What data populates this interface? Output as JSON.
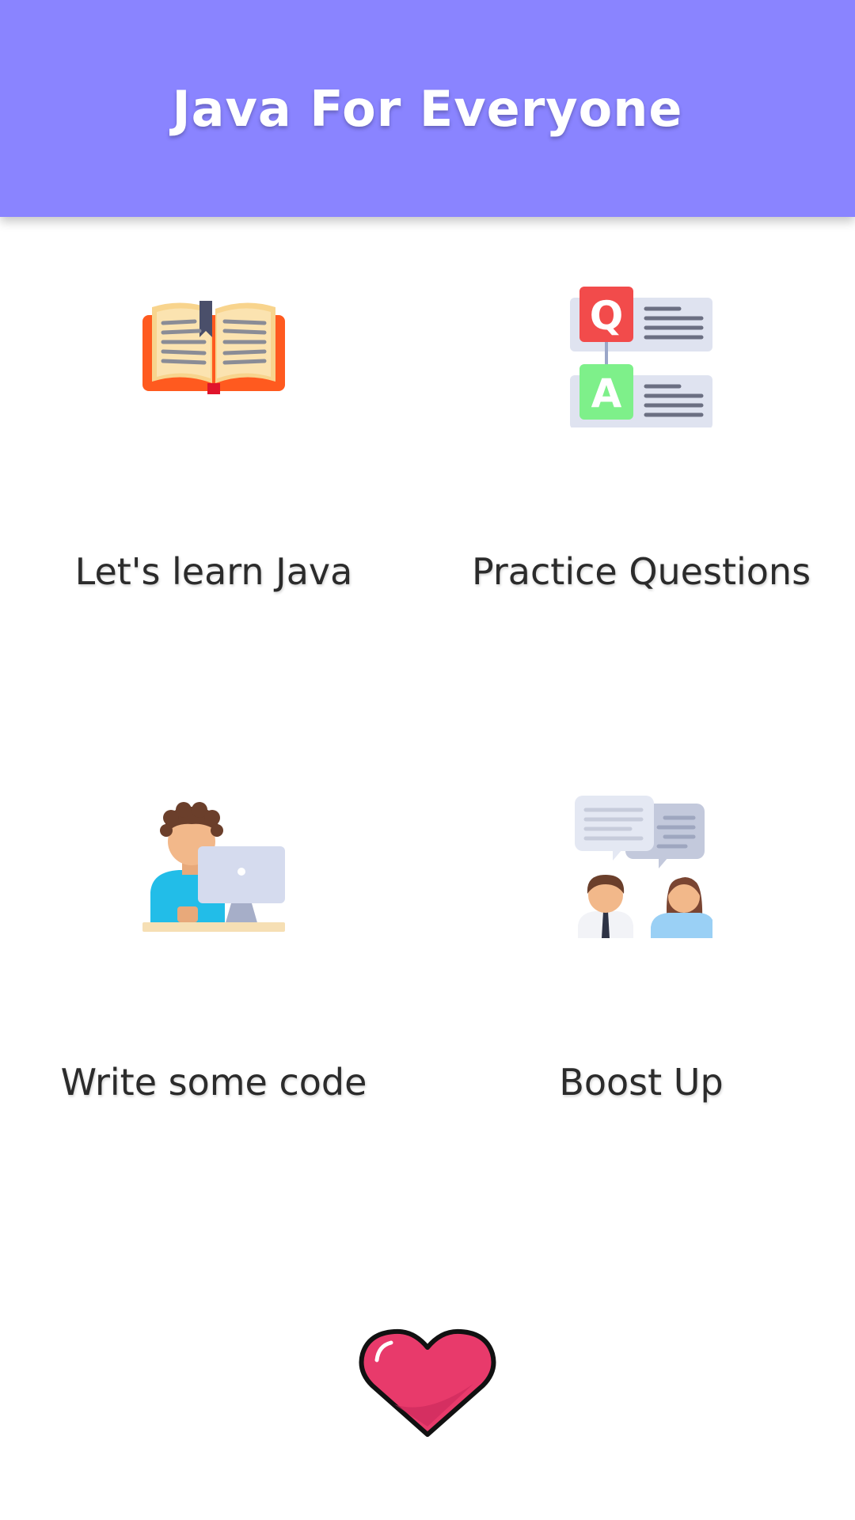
{
  "header": {
    "title": "Java For Everyone",
    "background": "#8a84ff"
  },
  "menu": [
    {
      "id": "learn",
      "label": "Let's learn Java",
      "icon": "open-book-icon"
    },
    {
      "id": "practice",
      "label": "Practice Questions",
      "icon": "question-answer-icon"
    },
    {
      "id": "code",
      "label": "Write some code",
      "icon": "person-at-computer-icon"
    },
    {
      "id": "boost",
      "label": "Boost Up",
      "icon": "people-chat-icon"
    }
  ],
  "footer": {
    "icon": "heart-icon",
    "heart_color": "#e83a6b"
  }
}
